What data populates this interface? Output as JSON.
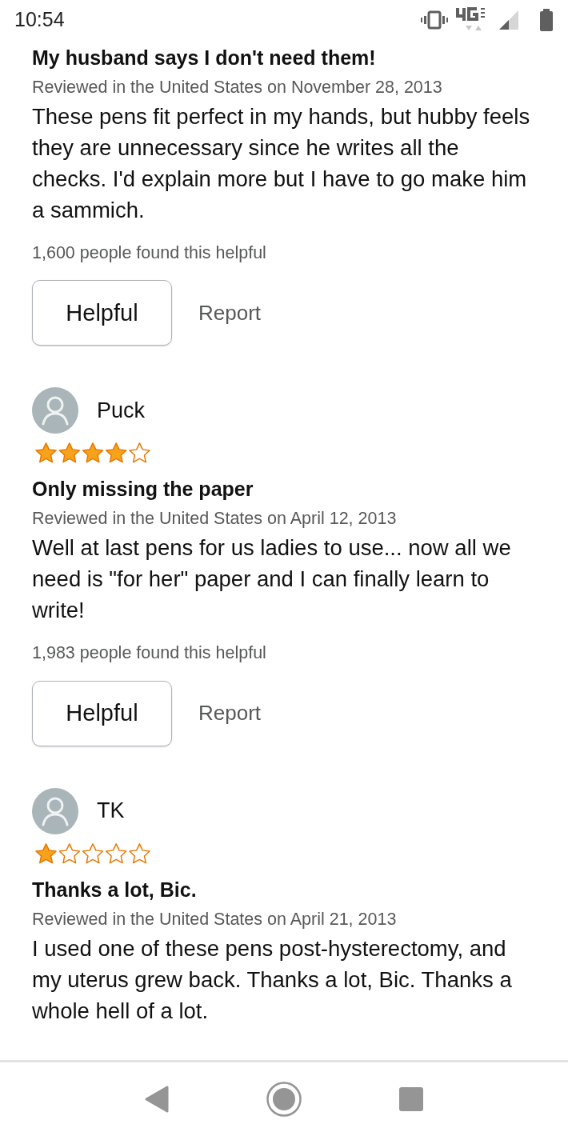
{
  "status_bar": {
    "time": "10:54"
  },
  "reviews": [
    {
      "title": "My husband says I don't need them!",
      "date": "Reviewed in the United States on November 28, 2013",
      "body": "These pens fit perfect in my hands, but hubby feels they are unnecessary since he writes all the checks. I'd explain more but I have to go make him a sammich.",
      "helpful_count": "1,600 people found this helpful",
      "helpful_button": "Helpful",
      "report": "Report"
    },
    {
      "author": "Puck",
      "stars": 4,
      "title": "Only missing the paper",
      "date": "Reviewed in the United States on April 12, 2013",
      "body": "Well at last pens for us ladies to use... now all we need is \"for her\" paper and I can finally learn to write!",
      "helpful_count": "1,983 people found this helpful",
      "helpful_button": "Helpful",
      "report": "Report"
    },
    {
      "author": "TK",
      "stars": 1,
      "title": "Thanks a lot, Bic.",
      "date": "Reviewed in the United States on April 21, 2013",
      "body": "I used one of these pens post-hysterectomy, and my uterus grew back. Thanks a lot, Bic. Thanks a whole hell of a lot."
    }
  ]
}
